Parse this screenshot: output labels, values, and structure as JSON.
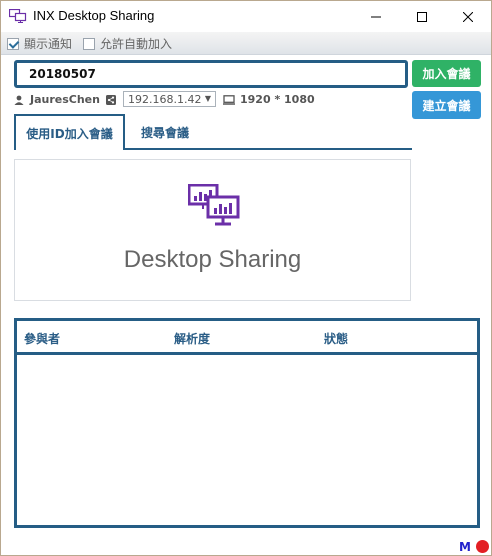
{
  "window": {
    "title": "INX Desktop Sharing",
    "controls": {
      "minimize": "—",
      "maximize": "☐",
      "close": "✕"
    }
  },
  "options": {
    "show_notification": {
      "label": "顯示通知",
      "checked": true
    },
    "allow_auto_join": {
      "label": "允許自動加入",
      "checked": false
    }
  },
  "meeting_id": {
    "value": "20180507"
  },
  "buttons": {
    "join": "加入會議",
    "create": "建立會議"
  },
  "user": {
    "name": "JauresChen",
    "ip": "192.168.1.42",
    "resolution": "1920 * 1080"
  },
  "tabs": [
    {
      "label": "使用ID加入會議",
      "active": true
    },
    {
      "label": "搜尋會議",
      "active": false
    }
  ],
  "banner": {
    "title": "Desktop Sharing"
  },
  "table": {
    "columns": [
      "參與者",
      "解析度",
      "狀態"
    ],
    "rows": []
  },
  "status": {
    "mode": "M",
    "indicator_color": "#e31e24"
  },
  "colors": {
    "primary": "#255d85",
    "join": "#2fb266",
    "create": "#3597d7",
    "icon": "#6b2fa8"
  }
}
